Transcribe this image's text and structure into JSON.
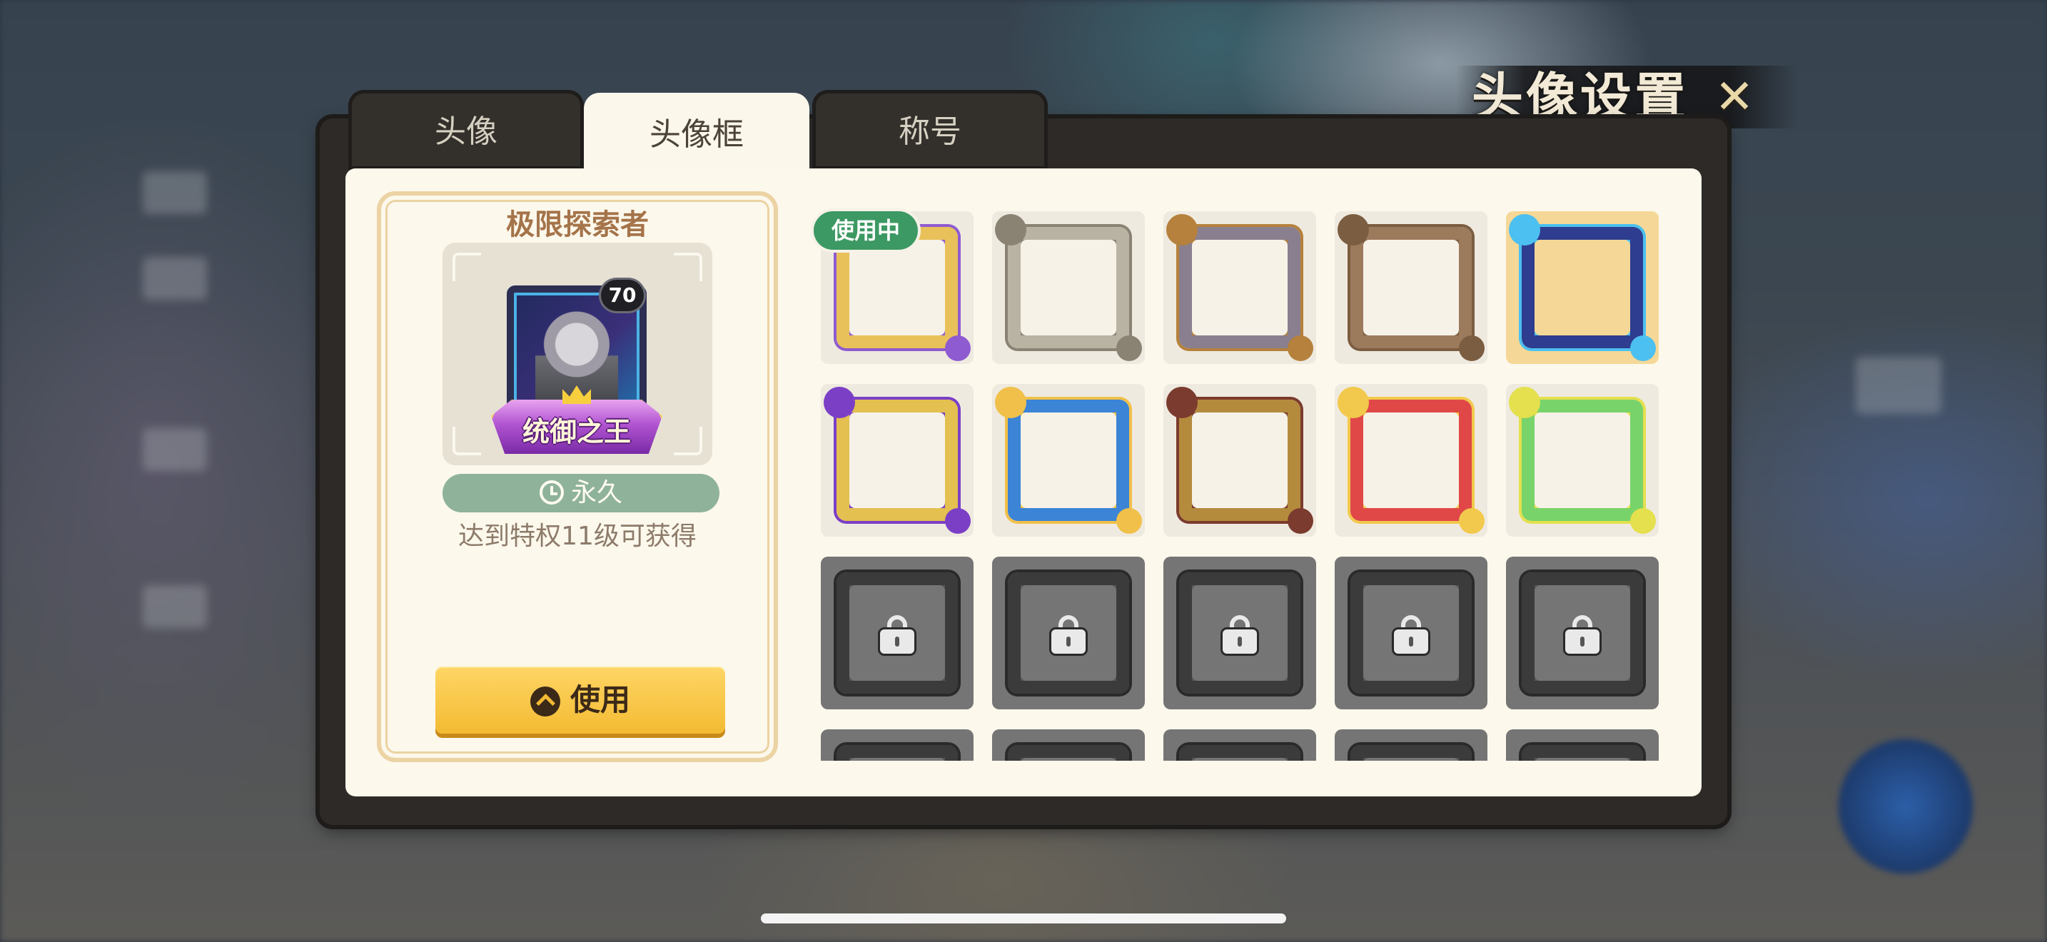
{
  "header": {
    "title": "头像设置",
    "close_label": "✕"
  },
  "tabs": [
    {
      "label": "头像",
      "active": false
    },
    {
      "label": "头像框",
      "active": true
    },
    {
      "label": "称号",
      "active": false
    }
  ],
  "detail": {
    "frame_name": "极限探索者",
    "level_badge": "70",
    "title_banner": "统御之王",
    "duration_label": "永久",
    "unlock_condition": "达到特权11级可获得",
    "use_button_label": "使用"
  },
  "grid": {
    "in_use_label": "使用中",
    "items": [
      {
        "id": 1,
        "state": "in-use",
        "color": "#e8c15a",
        "accent": "#8f5bd0"
      },
      {
        "id": 2,
        "state": "unlocked",
        "color": "#b9b3a3",
        "accent": "#8a8272"
      },
      {
        "id": 3,
        "state": "unlocked",
        "color": "#8a7f8e",
        "accent": "#b5813c"
      },
      {
        "id": 4,
        "state": "unlocked",
        "color": "#9c7a5c",
        "accent": "#7b5d41"
      },
      {
        "id": 5,
        "state": "selected",
        "color": "#2e3d8f",
        "accent": "#4cc0f0"
      },
      {
        "id": 6,
        "state": "unlocked",
        "color": "#e3c04f",
        "accent": "#7b3fc6"
      },
      {
        "id": 7,
        "state": "unlocked",
        "color": "#3b84d6",
        "accent": "#f0c04a"
      },
      {
        "id": 8,
        "state": "unlocked",
        "color": "#b48a3d",
        "accent": "#7b3b2e"
      },
      {
        "id": 9,
        "state": "unlocked",
        "color": "#e04848",
        "accent": "#f2c94c"
      },
      {
        "id": 10,
        "state": "unlocked",
        "color": "#78d36a",
        "accent": "#e4e04e"
      },
      {
        "id": 11,
        "state": "locked"
      },
      {
        "id": 12,
        "state": "locked"
      },
      {
        "id": 13,
        "state": "locked"
      },
      {
        "id": 14,
        "state": "locked"
      },
      {
        "id": 15,
        "state": "locked"
      },
      {
        "id": 16,
        "state": "locked"
      },
      {
        "id": 17,
        "state": "locked"
      },
      {
        "id": 18,
        "state": "locked"
      },
      {
        "id": 19,
        "state": "locked"
      },
      {
        "id": 20,
        "state": "locked"
      }
    ]
  }
}
